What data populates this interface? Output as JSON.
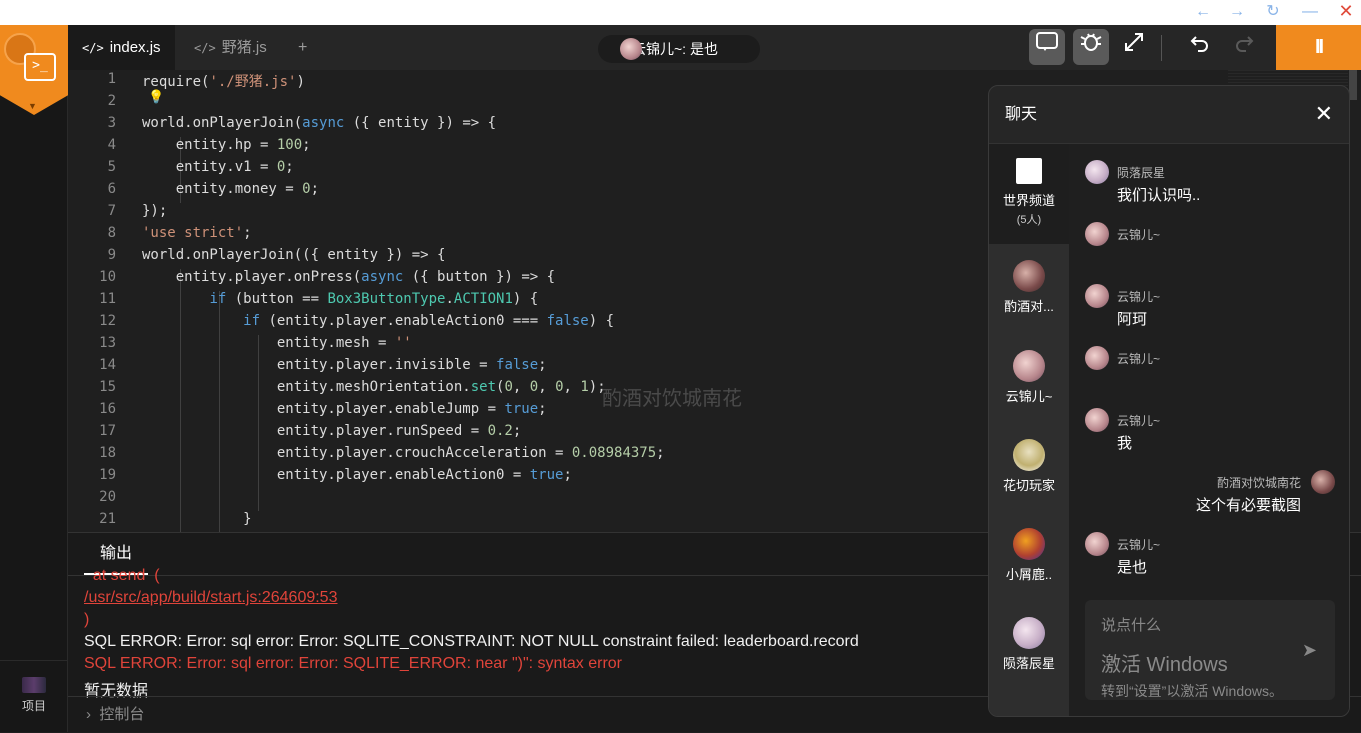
{
  "window_controls": {
    "back": "←",
    "forward": "→",
    "refresh": "↻",
    "minimize": "—",
    "close": "✕"
  },
  "sidebar": {
    "project_label": "项目"
  },
  "tabs": [
    {
      "label": "index.js",
      "icon": "</>"
    },
    {
      "label": "野猪.js",
      "icon": "</>"
    },
    {
      "label": "+"
    }
  ],
  "presence": {
    "text": "云锦儿~: 是也"
  },
  "toolbar": {
    "pause": "II"
  },
  "editor": {
    "line_numbers": [
      "1",
      "2",
      "3",
      "4",
      "5",
      "6",
      "7",
      "8",
      "9",
      "10",
      "11",
      "12",
      "13",
      "14",
      "15",
      "16",
      "17",
      "18",
      "19",
      "20",
      "21"
    ],
    "watermark": "酌酒对饮城南花"
  },
  "output": {
    "tab_label": "输出",
    "lines": [
      {
        "text": "  at send  (",
        "style": "red"
      },
      {
        "text": "/usr/src/app/build/start.js:264609:53",
        "style": "link"
      },
      {
        "text": ")",
        "style": "red"
      },
      {
        "text": "SQL ERROR: Error: sql error: Error: SQLITE_CONSTRAINT: NOT NULL constraint failed: leaderboard.record",
        "style": "white"
      },
      {
        "text": "SQL ERROR: Error: sql error: Error: SQLITE_ERROR: near \")\": syntax error",
        "style": "red"
      },
      {
        "text": "暂无数据",
        "style": "white"
      }
    ],
    "console_label": "控制台"
  },
  "chat": {
    "title": "聊天",
    "channels": [
      {
        "name": "世界频道",
        "sub": "(5人)"
      },
      {
        "name": "酌酒对..."
      },
      {
        "name": "云锦儿~"
      },
      {
        "name": "花切玩家"
      },
      {
        "name": "小屑鹿.."
      },
      {
        "name": "陨落辰星"
      }
    ],
    "messages": [
      {
        "sender": "陨落辰星",
        "text": "我们认识吗.."
      },
      {
        "sender": "云锦儿~",
        "text": ""
      },
      {
        "sender": "云锦儿~",
        "text": "阿珂"
      },
      {
        "sender": "云锦儿~",
        "text": ""
      },
      {
        "sender": "云锦儿~",
        "text": "我"
      },
      {
        "sender": "酌酒对饮城南花",
        "text": "这个有必要截图"
      },
      {
        "sender": "云锦儿~",
        "text": "是也"
      }
    ],
    "input_placeholder": "说点什么",
    "activation": {
      "title": "激活 Windows",
      "subtitle": "转到“设置”以激活 Windows。"
    }
  }
}
